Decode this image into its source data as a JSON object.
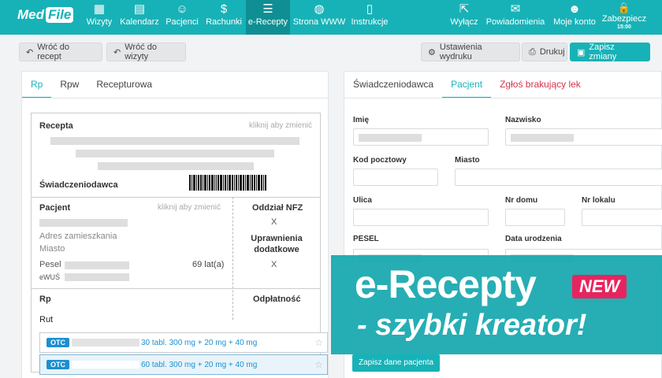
{
  "nav": {
    "logo_text": "Med",
    "logo_box": "File",
    "items_left": [
      {
        "label": "Wizyty",
        "icon": "▦"
      },
      {
        "label": "Kalendarz",
        "icon": "▤"
      },
      {
        "label": "Pacjenci",
        "icon": "☺"
      },
      {
        "label": "Rachunki",
        "icon": "$"
      },
      {
        "label": "e-Recepty",
        "icon": "☰"
      },
      {
        "label": "Strona WWW",
        "icon": "◍"
      },
      {
        "label": "Instrukcje",
        "icon": "▯"
      }
    ],
    "items_right": [
      {
        "label": "Wyłącz",
        "icon": "⇱"
      },
      {
        "label": "Powiadomienia",
        "icon": "✉"
      },
      {
        "label": "Moje konto",
        "icon": "☻"
      },
      {
        "label": "Zabezpiecz",
        "icon": "🔒",
        "sub": "15:00"
      }
    ]
  },
  "toolbar": {
    "back_recipes": "Wróć do recept",
    "back_visit": "Wróć do wizyty",
    "print_settings": "Ustawienia wydruku",
    "print": "Drukuj",
    "save": "Zapisz zmiany"
  },
  "left_tabs": [
    "Rp",
    "Rpw",
    "Recepturowa"
  ],
  "prescription": {
    "title": "Recepta",
    "click_change": "kliknij aby zmienić",
    "provider": "Świadczeniodawca",
    "patient": "Pacjent",
    "patient_click_change": "kliknij aby zmienić",
    "nfz": "Oddział NFZ",
    "nfz_value": "X",
    "address": "Adres zamieszkania",
    "city": "Miasto",
    "pesel": "Pesel",
    "age": "69 lat(a)",
    "ewus": "eWUŚ",
    "entitlements": "Uprawnienia dodatkowe",
    "entitlements_value": "X",
    "rp": "Rp",
    "payment": "Odpłatność",
    "drug_input": "Rut"
  },
  "autocomplete": [
    {
      "badge": "OTC",
      "text": "30 tabl. 300 mg + 20 mg + 40 mg"
    },
    {
      "badge": "OTC",
      "text": "60 tabl. 300 mg + 20 mg + 40 mg"
    }
  ],
  "right_tabs": [
    "Świadczeniodawca",
    "Pacjent",
    "Zgłoś brakujący lek"
  ],
  "patient_form": {
    "first_name": "Imię",
    "last_name": "Nazwisko",
    "postal_code": "Kod pocztowy",
    "city": "Miasto",
    "street": "Ulica",
    "house_no": "Nr domu",
    "flat_no": "Nr lokalu",
    "pesel": "PESEL",
    "birth_date": "Data urodzenia",
    "save_button": "Zapisz dane pacjenta"
  },
  "banner": {
    "line1": "e-Recepty",
    "line2": "- szybki kreator!",
    "badge": "NEW"
  },
  "colors": {
    "accent": "#17b2b7",
    "badge": "#e8245f",
    "otc": "#1d8fcf"
  }
}
